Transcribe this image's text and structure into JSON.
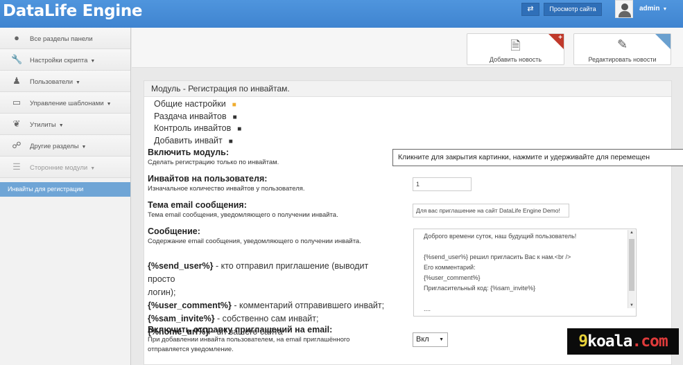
{
  "header": {
    "logo": "DataLife Engine",
    "swap_icon": "⇄",
    "view_site": "Просмотр сайта",
    "user": "admin"
  },
  "sidebar": {
    "items": [
      {
        "label": "Все разделы панели",
        "icon": "globe-icon",
        "caret": false
      },
      {
        "label": "Настройки скрипта",
        "icon": "wrench-icon",
        "caret": true
      },
      {
        "label": "Пользователи",
        "icon": "user-icon",
        "caret": true
      },
      {
        "label": "Управление шаблонами",
        "icon": "laptop-icon",
        "caret": true
      },
      {
        "label": "Утилиты",
        "icon": "leaf-icon",
        "caret": true
      },
      {
        "label": "Другие разделы",
        "icon": "links-icon",
        "caret": true
      },
      {
        "label": "Сторонние модули",
        "icon": "list-icon",
        "caret": true
      }
    ],
    "active": "Инвайты для регистрации"
  },
  "toolbar": {
    "add_news": "Добавить новость",
    "edit_news": "Редактировать новости"
  },
  "panel": {
    "title": "Модуль - Регистрация по инвайтам.",
    "links": [
      "Общие настройки",
      "Раздача инвайтов",
      "Контроль инвайтов",
      "Добавить инвайт"
    ],
    "settings": {
      "enable": {
        "title": "Включить модуль:",
        "desc": "Сделать регистрацию только по инвайтам."
      },
      "invites": {
        "title": "Инвайтов на пользователя:",
        "desc": "Изначальное количество инвайтов у пользователя.",
        "value": "1"
      },
      "subject": {
        "title": "Тема email сообщения:",
        "desc": "Тема email сообщения, уведомляющего о получении инвайта.",
        "value": "Для вас приглашение на сайт DataLife Engine Demo!"
      },
      "message": {
        "title": "Сообщение:",
        "desc": "Содержание email сообщения, уведомляющего о получении инвайта.",
        "lines": [
          "Доброго времени суток, наш будущий пользователь!",
          "",
          "{%send_user%} решил пригласить Вас к нам.<br />",
          "Его комментарий:",
          "{%user_comment%}",
          "Пригласительный код: {%sam_invite%}",
          "",
          "...."
        ]
      },
      "vars": [
        {
          "key": "{%send_user%}",
          "text": " - кто отправил приглашение (выводит просто"
        },
        {
          "key": "",
          "text": "логин);"
        },
        {
          "key": "{%user_comment%}",
          "text": " - комментарий отправившего инвайт;"
        },
        {
          "key": "{%sam_invite%}",
          "text": " - собственно сам инвайт;"
        },
        {
          "key": "{%home_url%}",
          "text": " - url вашего сайта"
        }
      ],
      "email_send": {
        "title": "Включить отправку приглашений на email:",
        "desc1": "При добавлении инвайта пользователем, на email приглашённого",
        "desc2": "отправляется уведомление.",
        "value": "Вкл"
      }
    }
  },
  "tooltip": "Кликните для закрытия картинки, нажмите и удерживайте для перемещен",
  "watermark": {
    "num": "9",
    "name": "koala",
    "dom": ".com"
  }
}
